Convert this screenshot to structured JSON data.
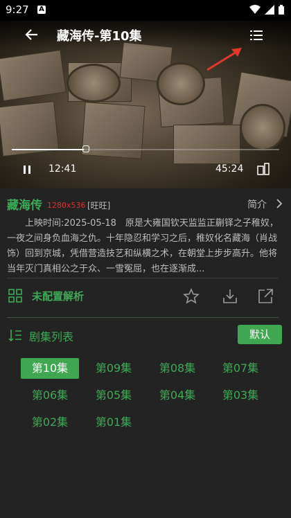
{
  "status_bar": {
    "time": "9:27",
    "notification_icon": "A"
  },
  "header": {
    "title": "藏海传-第10集",
    "back_icon": "back-arrow-icon",
    "list_icon": "list-icon"
  },
  "player": {
    "progress_fraction": 0.27,
    "current_time": "12:41",
    "duration": "45:24"
  },
  "info": {
    "show_name": "藏海传",
    "resolution": "1280x536",
    "source": "[旺旺]",
    "intro_label": "简介",
    "description": "上映时间:2025-05-18　原是大雍国钦天监监正蒯铎之子稚奴，一夜之间身负血海之仇。十年隐忍和学习之后，稚奴化名藏海（肖战 饰）回到京城，凭借营造技艺和纵横之术，在朝堂上步步高升。他将当年灭门真相公之于众、一雪冤屈，也在逐渐成..."
  },
  "actions": {
    "parse_label": "未配置解析"
  },
  "episodes": {
    "label": "剧集列表",
    "default_button": "默认",
    "items": [
      "第10集",
      "第09集",
      "第08集",
      "第07集",
      "第06集",
      "第05集",
      "第04集",
      "第03集",
      "第02集",
      "第01集"
    ],
    "active_index": 0
  },
  "colors": {
    "accent": "#3daa55",
    "resolution": "#e03030",
    "background": "#232323"
  }
}
